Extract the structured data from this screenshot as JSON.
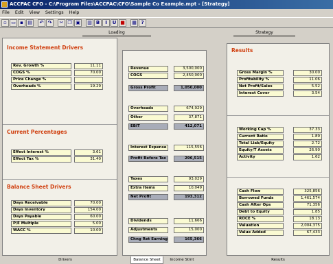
{
  "window": {
    "title": "ACCPAC CFO - C:\\Program Files\\ACCPAC\\CFO\\Sample Co Example.mpt - [Strategy]"
  },
  "menu": [
    "File",
    "Edit",
    "View",
    "Settings",
    "Help"
  ],
  "toolbar": [
    "new-icon",
    "open-icon",
    "save-icon",
    "print-icon",
    "undo-icon",
    "redo-icon",
    "cut-icon",
    "copy-icon",
    "paste-icon",
    "chart-icon",
    "bold-icon",
    "italic-icon",
    "underline-icon",
    "color-icon",
    "calc-icon",
    "help-icon"
  ],
  "top_tabs": {
    "left": "Loading",
    "right": "Strategy"
  },
  "left": {
    "income": {
      "title": "Income Statement Drivers",
      "rows": [
        {
          "label": "Rev. Growth %",
          "value": "11.11"
        },
        {
          "label": "COGS %",
          "value": "70.00"
        },
        {
          "label": "Price Change %",
          "value": ""
        },
        {
          "label": "Overheads %",
          "value": "19.29"
        }
      ]
    },
    "current": {
      "title": "Current Percentages",
      "rows": [
        {
          "label": "Effect Interest %",
          "value": "3.61"
        },
        {
          "label": "Effect Tax %",
          "value": "31.40"
        }
      ]
    },
    "balance": {
      "title": "Balance Sheet Drivers",
      "rows": [
        {
          "label": "Days Receivable",
          "value": "70.00"
        },
        {
          "label": "Days Inventory",
          "value": "154.00"
        },
        {
          "label": "Days Payable",
          "value": "60.00"
        },
        {
          "label": "P/E Multiple",
          "value": "5.00"
        },
        {
          "label": "WACC %",
          "value": "10.00"
        }
      ]
    }
  },
  "middle": {
    "rows": [
      {
        "label": "Revenue",
        "value": "3,500,000",
        "dark": false
      },
      {
        "label": "COGS",
        "value": "2,450,000",
        "dark": false
      },
      {
        "label": "Gross Profit",
        "value": "1,050,000",
        "dark": true
      },
      {
        "label": "Overheads",
        "value": "674,929",
        "dark": false
      },
      {
        "label": "Other",
        "value": "37,871",
        "dark": false
      },
      {
        "label": "EBIT",
        "value": "412,071",
        "dark": true
      },
      {
        "label": "Interest Expense",
        "value": "115,556",
        "dark": false
      },
      {
        "label": "Profit Before Tax",
        "value": "296,515",
        "dark": true
      },
      {
        "label": "Taxes",
        "value": "93,029",
        "dark": false
      },
      {
        "label": "Extra Items",
        "value": "10,049",
        "dark": false
      },
      {
        "label": "Net Profit",
        "value": "193,312",
        "dark": true
      },
      {
        "label": "Dividends",
        "value": "11,666",
        "dark": false
      },
      {
        "label": "Adjustments",
        "value": "15,000",
        "dark": false
      },
      {
        "label": "Chng Ret Earnings",
        "value": "165,366",
        "dark": true
      }
    ]
  },
  "right": {
    "title": "Results",
    "results": [
      {
        "label": "Gross Margin %",
        "value": "30.00"
      },
      {
        "label": "Profitability %",
        "value": "11.06"
      },
      {
        "label": "Net Profit/Sales",
        "value": "5.52"
      },
      {
        "label": "Interest Cover",
        "value": "3.54"
      }
    ],
    "ratios": [
      {
        "label": "Working Cap %",
        "value": "37.33"
      },
      {
        "label": "Current Ratio",
        "value": "1.89"
      },
      {
        "label": "Total Liab/Equity",
        "value": "2.72"
      },
      {
        "label": "Equity/T Assets",
        "value": "26.90"
      },
      {
        "label": "Activity",
        "value": "1.62"
      }
    ],
    "cash": [
      {
        "label": "Cash Flow",
        "value": "325,856"
      },
      {
        "label": "Borrowed Funds",
        "value": "1,461,574"
      },
      {
        "label": "Cash After Ops",
        "value": "71,356"
      },
      {
        "label": "Debt to Equity",
        "value": "1.85"
      },
      {
        "label": "ROCE %",
        "value": "18.13"
      },
      {
        "label": "Valuation",
        "value": "2,004,375"
      },
      {
        "label": "Value Added",
        "value": "67,433"
      }
    ]
  },
  "bottom_tabs": [
    "Drivers",
    "Balance Sheet",
    "Income Stmt",
    "Results"
  ]
}
